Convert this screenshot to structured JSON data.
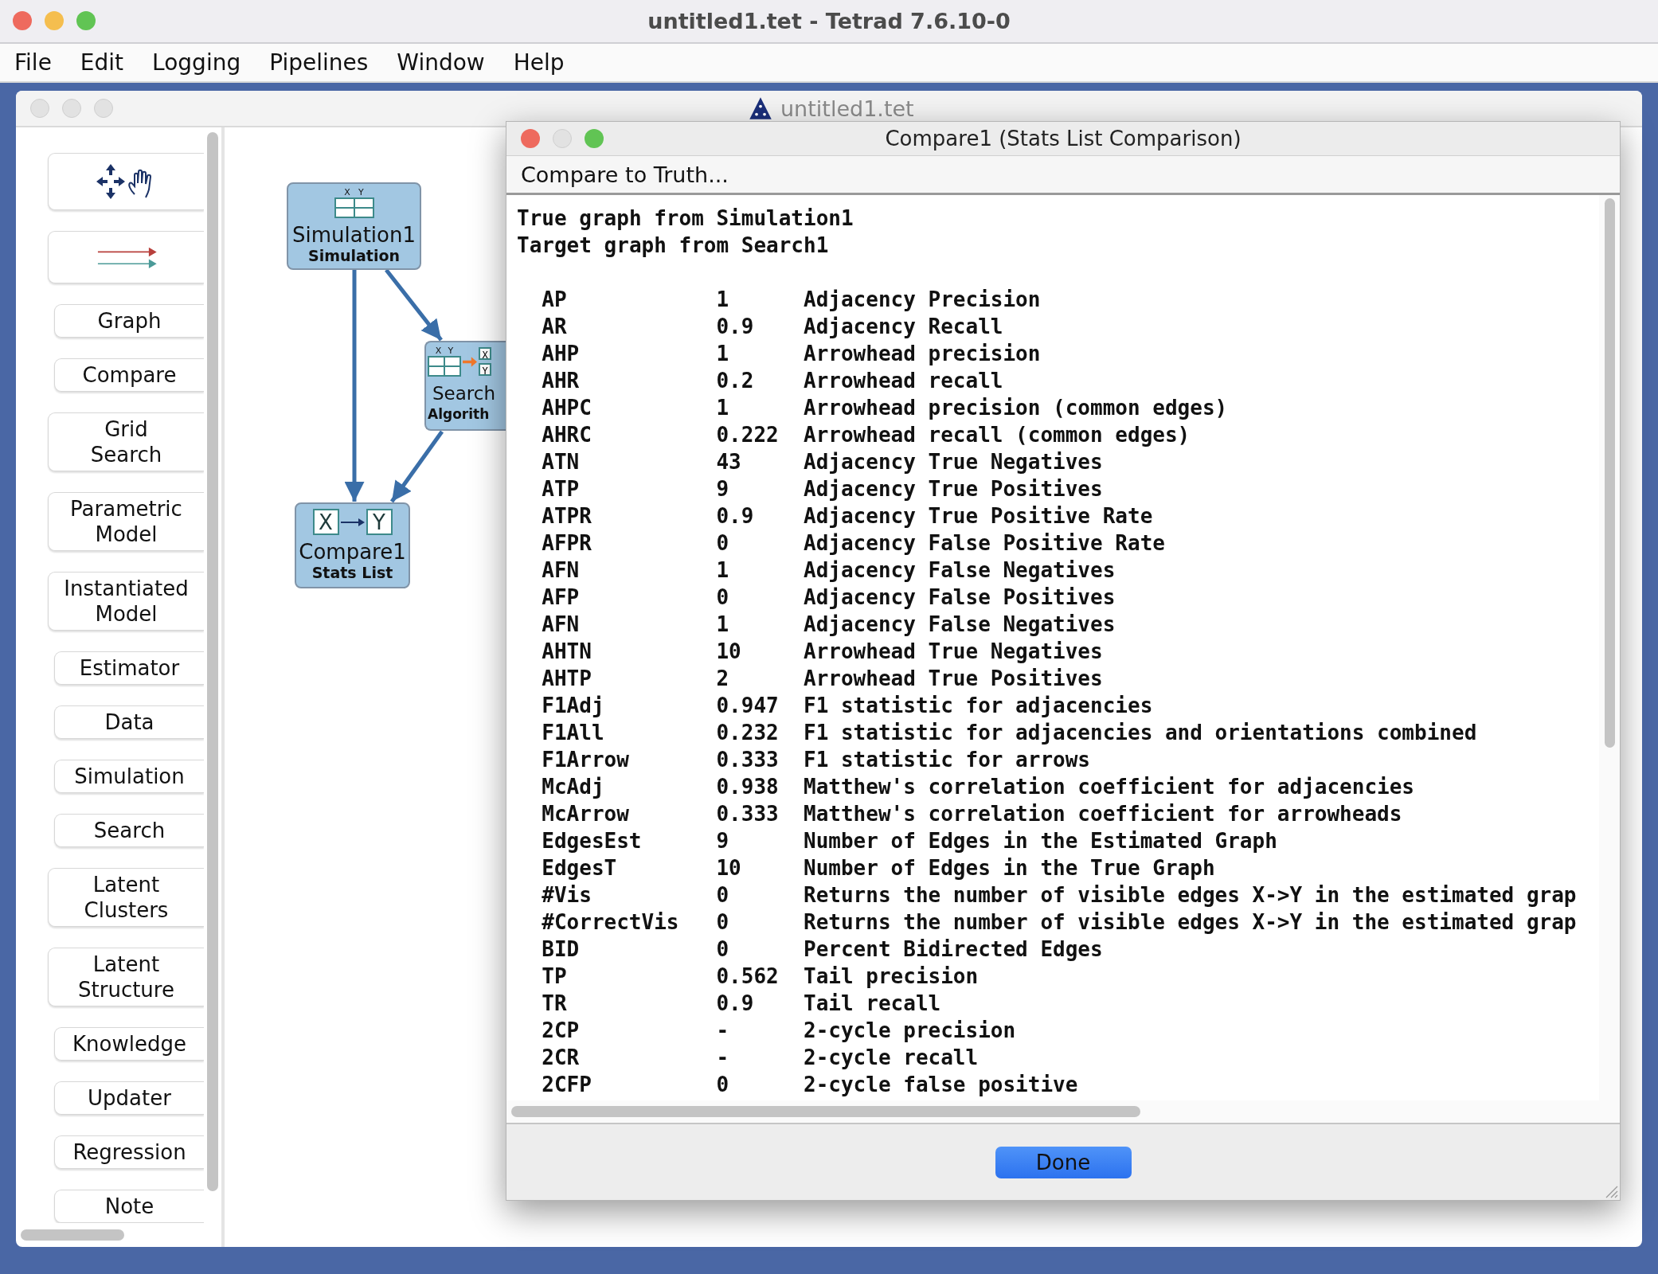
{
  "window": {
    "title": "untitled1.tet - Tetrad 7.6.10-0"
  },
  "menu": [
    "File",
    "Edit",
    "Logging",
    "Pipelines",
    "Window",
    "Help"
  ],
  "document_window": {
    "title": "untitled1.tet"
  },
  "palette": [
    {
      "label": "Graph"
    },
    {
      "label": "Compare"
    },
    {
      "label": "Grid\nSearch"
    },
    {
      "label": "Parametric\nModel"
    },
    {
      "label": "Instantiated\nModel"
    },
    {
      "label": "Estimator"
    },
    {
      "label": "Data"
    },
    {
      "label": "Simulation"
    },
    {
      "label": "Search"
    },
    {
      "label": "Latent\nClusters"
    },
    {
      "label": "Latent\nStructure"
    },
    {
      "label": "Knowledge"
    },
    {
      "label": "Updater"
    },
    {
      "label": "Regression"
    },
    {
      "label": "Note"
    }
  ],
  "canvas": {
    "nodes": [
      {
        "kind": "simulation",
        "name": "Simulation1",
        "type": "Simulation",
        "icon_labels": [
          "X",
          "Y"
        ]
      },
      {
        "kind": "search",
        "name": "Search",
        "type": "Algorith",
        "icon_labels": [
          "X",
          "Y",
          "X",
          "Y"
        ]
      },
      {
        "kind": "compare",
        "name": "Compare1",
        "type": "Stats List",
        "icon_labels": [
          "X",
          "Y"
        ]
      }
    ]
  },
  "dialog": {
    "title": "Compare1 (Stats List Comparison)",
    "menu": "Compare to Truth...",
    "header": [
      "True graph from Simulation1",
      "Target graph from Search1"
    ],
    "stats": [
      {
        "key": "AP",
        "value": "1",
        "description": "Adjacency Precision"
      },
      {
        "key": "AR",
        "value": "0.9",
        "description": "Adjacency Recall"
      },
      {
        "key": "AHP",
        "value": "1",
        "description": "Arrowhead precision"
      },
      {
        "key": "AHR",
        "value": "0.2",
        "description": "Arrowhead recall"
      },
      {
        "key": "AHPC",
        "value": "1",
        "description": "Arrowhead precision (common edges)"
      },
      {
        "key": "AHRC",
        "value": "0.222",
        "description": "Arrowhead recall (common edges)"
      },
      {
        "key": "ATN",
        "value": "43",
        "description": "Adjacency True Negatives"
      },
      {
        "key": "ATP",
        "value": "9",
        "description": "Adjacency True Positives"
      },
      {
        "key": "ATPR",
        "value": "0.9",
        "description": "Adjacency True Positive Rate"
      },
      {
        "key": "AFPR",
        "value": "0",
        "description": "Adjacency False Positive Rate"
      },
      {
        "key": "AFN",
        "value": "1",
        "description": "Adjacency False Negatives"
      },
      {
        "key": "AFP",
        "value": "0",
        "description": "Adjacency False Positives"
      },
      {
        "key": "AFN",
        "value": "1",
        "description": "Adjacency False Negatives"
      },
      {
        "key": "AHTN",
        "value": "10",
        "description": "Arrowhead True Negatives"
      },
      {
        "key": "AHTP",
        "value": "2",
        "description": "Arrowhead True Positives"
      },
      {
        "key": "F1Adj",
        "value": "0.947",
        "description": "F1 statistic for adjacencies"
      },
      {
        "key": "F1All",
        "value": "0.232",
        "description": "F1 statistic for adjacencies and orientations combined"
      },
      {
        "key": "F1Arrow",
        "value": "0.333",
        "description": "F1 statistic for arrows"
      },
      {
        "key": "McAdj",
        "value": "0.938",
        "description": "Matthew's correlation coefficient for adjacencies"
      },
      {
        "key": "McArrow",
        "value": "0.333",
        "description": "Matthew's correlation coefficient for arrowheads"
      },
      {
        "key": "EdgesEst",
        "value": "9",
        "description": "Number of Edges in the Estimated Graph"
      },
      {
        "key": "EdgesT",
        "value": "10",
        "description": "Number of Edges in the True Graph"
      },
      {
        "key": "#Vis",
        "value": "0",
        "description": "Returns the number of visible edges X->Y in the estimated grap"
      },
      {
        "key": "#CorrectVis",
        "value": "0",
        "description": "Returns the number of visible edges X->Y in the estimated grap"
      },
      {
        "key": "BID",
        "value": "0",
        "description": "Percent Bidirected Edges"
      },
      {
        "key": "TP",
        "value": "0.562",
        "description": "Tail precision"
      },
      {
        "key": "TR",
        "value": "0.9",
        "description": "Tail recall"
      },
      {
        "key": "2CP",
        "value": "-",
        "description": "2-cycle precision"
      },
      {
        "key": "2CR",
        "value": "-",
        "description": "2-cycle recall"
      },
      {
        "key": "2CFP",
        "value": "0",
        "description": "2-cycle false positive"
      }
    ],
    "button": "Done"
  }
}
